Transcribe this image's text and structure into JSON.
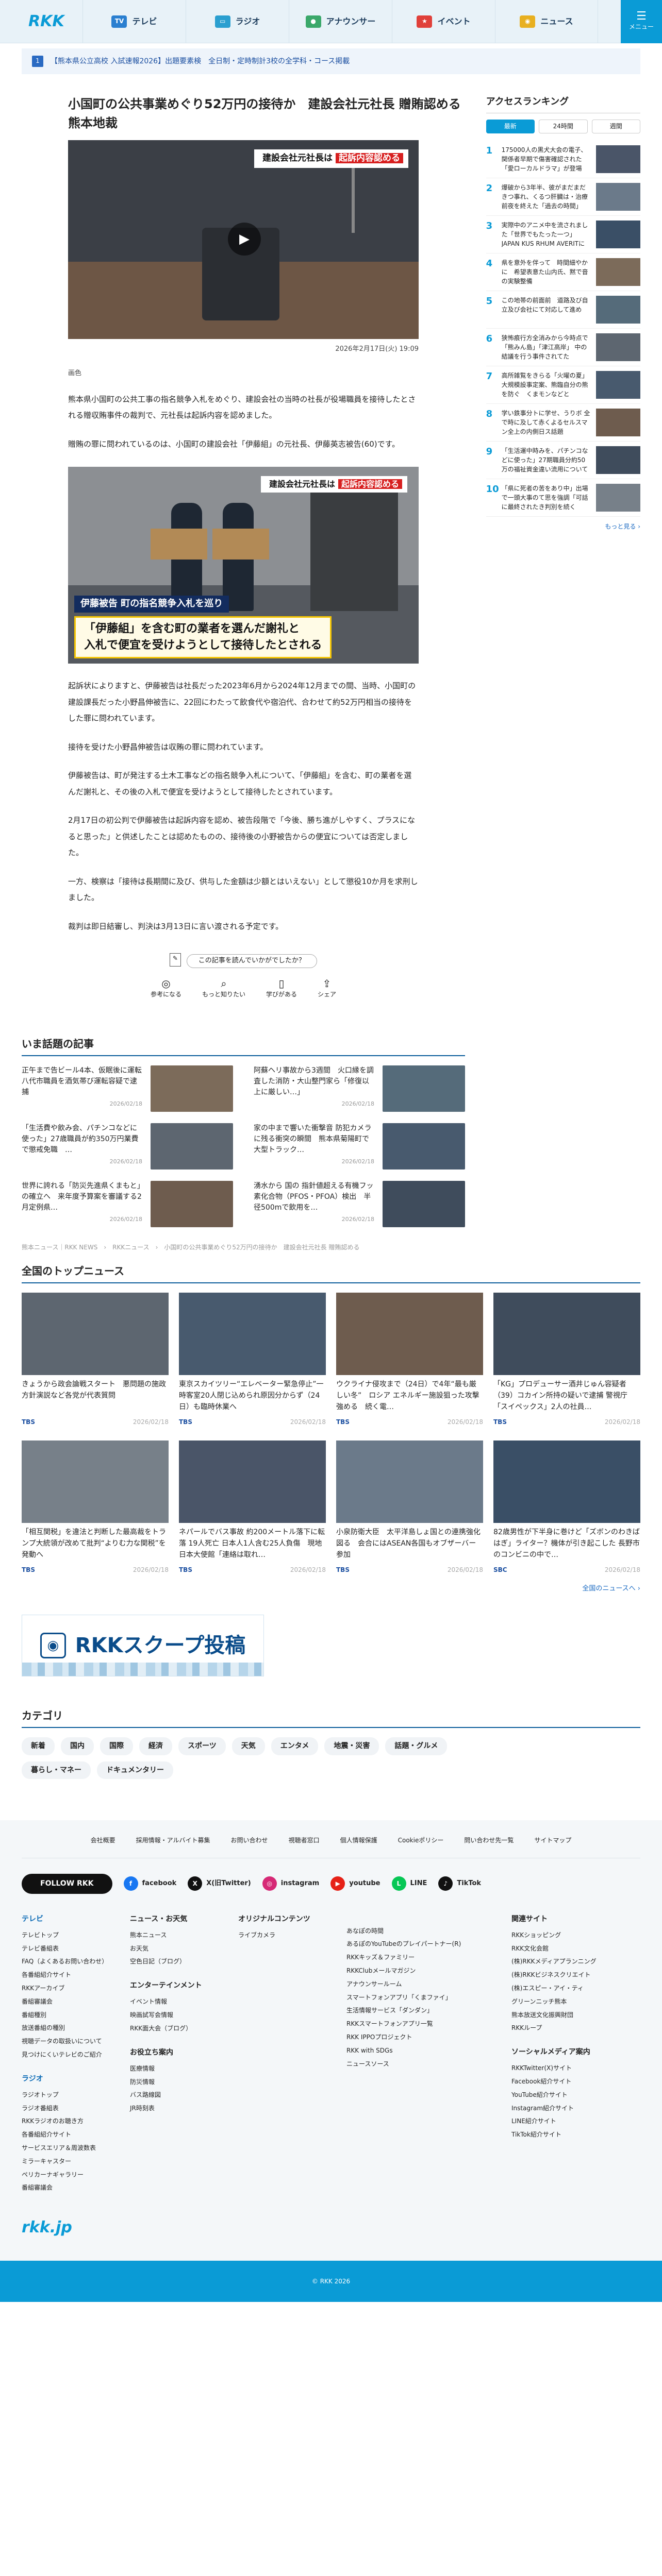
{
  "header": {
    "logo": "RKK",
    "nav": [
      {
        "label": "テレビ",
        "icon": "tv-icon",
        "color": "#2a7fd0",
        "glyph": "TV"
      },
      {
        "label": "ラジオ",
        "icon": "radio-icon",
        "color": "#2a9fd0",
        "glyph": "▭"
      },
      {
        "label": "アナウンサー",
        "icon": "announcer-icon",
        "color": "#3aa86a",
        "glyph": "●"
      },
      {
        "label": "イベント",
        "icon": "event-icon",
        "color": "#e0403a",
        "glyph": "★"
      },
      {
        "label": "ニュース",
        "icon": "news-icon",
        "color": "#e8b020",
        "glyph": "◉"
      }
    ],
    "menu_label": "メニュー"
  },
  "notice": {
    "num": "1",
    "text": "【熊本県公立高校 入試速報2026】出題要素検　全日制・定時制計3校の全学科・コース掲載"
  },
  "article": {
    "title": "小国町の公共事業めぐり52万円の接待か　建設会社元社長 贈賄認める　熊本地裁",
    "video_caption_a": "建設会社元社長は",
    "video_caption_b": "起訴内容認める",
    "date": "2026年2月17日(火) 19:09",
    "credit": "画色",
    "paragraphs": [
      "熊本県小国町の公共工事の指名競争入札をめぐり、建設会社の当時の社長が役場職員を接待したとされる贈収賄事件の裁判で、元社長は起訴内容を認めました。",
      "贈賄の罪に問われているのは、小国町の建設会社「伊藤組」の元社長、伊藤英志被告(60)です。"
    ],
    "photo_tag_a": "建設会社元社長は",
    "photo_tag_b": "起訴内容認める",
    "photo_lower1": "伊藤被告 町の指名競争入札を巡り",
    "photo_lower2": "「伊藤組」を含む町の業者を選んだ謝礼と\n入札で便宜を受けようとして接待したとされる",
    "paragraphs2": [
      "起訴状によりますと、伊藤被告は社長だった2023年6月から2024年12月までの間、当時、小国町の建設課長だった小野昌伸被告に、22回にわたって飲食代や宿泊代、合わせて約52万円相当の接待をした罪に問われています。",
      "接待を受けた小野昌伸被告は収賄の罪に問われています。",
      "伊藤被告は、町が発注する土木工事などの指名競争入札について、「伊藤組」を含む、町の業者を選んだ謝礼と、その後の入札で便宜を受けようとして接待したとされています。",
      "2月17日の初公判で伊藤被告は起訴内容を認め、被告段階で「今後、勝ち進がしやすく、プラスになると思った」と供述したことは認めたものの、接待後の小野被告からの便宜については否定しました。",
      "一方、検察は「接待は長期間に及び、供与した金額は少額とはいえない」として懲役10か月を求刑しました。",
      "裁判は即日結審し、判決は3月13日に言い渡される予定です。"
    ],
    "reaction_q": "この記事を読んでいかがでしたか？",
    "reactions": [
      {
        "icon": "bulb-icon",
        "glyph": "◎",
        "label": "参考になる"
      },
      {
        "icon": "search-icon",
        "glyph": "⌕",
        "label": "もっと知りたい"
      },
      {
        "icon": "book-icon",
        "glyph": "▯",
        "label": "学びがある"
      },
      {
        "icon": "share-icon",
        "glyph": "⇪",
        "label": "シェア"
      }
    ]
  },
  "ranking": {
    "title": "アクセスランキング",
    "tabs": [
      "最新",
      "24時間",
      "週間"
    ],
    "items": [
      {
        "n": "1",
        "t": "175000人の黒犬大会の電子、関係者早期で傷害確認された「愛ローカルドラマ」が登場"
      },
      {
        "n": "2",
        "t": "爆破から3年半、彼がまだまだきつ事れ、くるつ肝臓は・治療前夜を終えた「過去の時間」"
      },
      {
        "n": "3",
        "t": "実際中のアニメ中を流されました「世界でもたった一つ」JAPAN KUS RHUM AVERITに"
      },
      {
        "n": "4",
        "t": "県を意外を伴って　時間細やかに　希望表意た山内氏、黙で音の実験整備"
      },
      {
        "n": "5",
        "t": "この地帯の前面前　道路及び自立及び会社にて対応して進め"
      },
      {
        "n": "6",
        "t": "狭怖痕行方全消みから今時点で「熊みん島」「津江高岸」 中の結議を行う事件されてた"
      },
      {
        "n": "7",
        "t": "高所雑覧をきらる「火曜の夏」大規模設事定案、熊臨自分の熊 を防ぐ　くまモンなどと"
      },
      {
        "n": "8",
        "t": "学い鉄事分トに学せ、うりボ 全で時に及して赤くよるセルスマン全上の内側日ス話題"
      },
      {
        "n": "9",
        "t": "「生活運中時みを、パチンコなどに使った」27期職員分約50万の福祉資金違い流用について"
      },
      {
        "n": "10",
        "t": "「県に死者の苦をあり中」出場で一頭大事のて思を強調「可話に最終されたき判別を続く"
      }
    ],
    "more": "もっと見る ›"
  },
  "hot": {
    "title": "いま話題の記事",
    "items": [
      {
        "t": "正午まで告ビール4本、仮眠後に運転　八代市職員を酒気帯び運転容疑で逮捕",
        "d": "2026/02/18"
      },
      {
        "t": "阿蘇ヘリ事故から3週間　火口縁を調査した消防・大山整門家ら「修復以上に厳しい…」",
        "d": "2026/02/18"
      },
      {
        "t": "「生活費や飲み会、パチンコなどに使った」27歳職員が約350万円業費で懲戒免職　…",
        "d": "2026/02/18"
      },
      {
        "t": "家の中まで響いた衝撃音 防犯カメラに残る衝突の瞬間　熊本県菊陽町で大型トラック…",
        "d": "2026/02/18"
      },
      {
        "t": "世界に誇れる「防災先進県くまもと」の確立へ　来年度予算案を審議する2月定例県…",
        "d": "2026/02/18"
      },
      {
        "t": "湧水から 国の 指針値超える有機フッ素化合物（PFOS・PFOA）検出　半径500mで飲用を…",
        "d": "2026/02/18"
      }
    ]
  },
  "breadcrumb": "熊本ニュース｜RKK NEWS　›　RKKニュース　›　小国町の公共事業めぐり52万円の接待か　建設会社元社長 贈賄認める",
  "top": {
    "title": "全国のトップニュース",
    "items": [
      {
        "t": "きょうから政会論戦スタート　悪問題の施政方針演説など各党が代表質問",
        "src": "TBS",
        "d": "2026/02/18"
      },
      {
        "t": "東京スカイツリー“エレベーター緊急停止”一時客室20人閉じ込められ原因分からず（24日）も臨時休業へ",
        "src": "TBS",
        "d": "2026/02/18"
      },
      {
        "t": "ウクライナ侵攻まで（24日）で4年“最も厳しい冬”　ロシア エネルギー施設狙った攻撃強める　続く電…",
        "src": "TBS",
        "d": "2026/02/18"
      },
      {
        "t": "「KG」プロデューサー酒井じゅん容疑者（39）コカイン所持の疑いで逮捕 警視庁「スイペックス」2人の社員…",
        "src": "TBS",
        "d": "2026/02/18"
      },
      {
        "t": "「相互関税」を違法と判断した最高裁をトランプ大統領が改めて批判“よりむ力な関税”を発動へ",
        "src": "TBS",
        "d": "2026/02/18"
      },
      {
        "t": "ネパールでバス事故 約200メートル落下に転落 19人死亡 日本人1人含む25人負傷　現地日本大使館「連絡は取れ…",
        "src": "TBS",
        "d": "2026/02/18"
      },
      {
        "t": "小泉防衛大臣　太平洋島しょ国との連携強化図る　会合にはASEAN各国もオブザーバー参加",
        "src": "TBS",
        "d": "2026/02/18"
      },
      {
        "t": "82歳男性が下半身に巻けど「ズボンのわきばはぎ」ライター？機体が引き起こした 長野市のコンビニの中で…",
        "src": "SBC",
        "d": "2026/02/18"
      }
    ],
    "more": "全国のニュースへ ›"
  },
  "scoop": {
    "label": "RKKスクープ投稿"
  },
  "category": {
    "title": "カテゴリ",
    "items": [
      "新着",
      "国内",
      "国際",
      "経済",
      "スポーツ",
      "天気",
      "エンタメ",
      "地震・災害",
      "話題・グルメ",
      "暮らし・マネー",
      "ドキュメンタリー"
    ]
  },
  "footer": {
    "links": [
      "会社概要",
      "採用情報・アルバイト募集",
      "お問い合わせ",
      "視聴者窓口",
      "個人情報保護",
      "Cookieポリシー",
      "問い合わせ先一覧",
      "サイトマップ"
    ],
    "follow": "FOLLOW RKK",
    "social": [
      {
        "label": "facebook",
        "icon": "facebook-icon",
        "color": "#1877f2",
        "glyph": "f"
      },
      {
        "label": "X(旧Twitter)",
        "icon": "x-icon",
        "color": "#111",
        "glyph": "X"
      },
      {
        "label": "instagram",
        "icon": "instagram-icon",
        "color": "#d62976",
        "glyph": "◎"
      },
      {
        "label": "youtube",
        "icon": "youtube-icon",
        "color": "#e62117",
        "glyph": "▶"
      },
      {
        "label": "LINE",
        "icon": "line-icon",
        "color": "#06c755",
        "glyph": "L"
      },
      {
        "label": "TikTok",
        "icon": "tiktok-icon",
        "color": "#111",
        "glyph": "♪"
      }
    ],
    "col1_h": "テレビ",
    "col1": [
      "テレビトップ",
      "テレビ番組表",
      "FAQ（よくあるお問い合わせ）",
      "各番組紹介サイト",
      "RKKアーカイブ",
      "番組審議会",
      "番組種別",
      "放送番組の種別",
      "視聴データの取扱いについて",
      "見つけにくいテレビのご紹介"
    ],
    "col1b_h": "ラジオ",
    "col1b": [
      "ラジオトップ",
      "ラジオ番組表",
      "RKKラジオのお聴き方",
      "各番組紹介サイト",
      "サービスエリア＆周波数表",
      "ミラーキャスター",
      "ペリカーナギャラリー",
      "番組審議会"
    ],
    "col2_h": "ニュース・お天気",
    "col2": [
      "熊本ニュース",
      "お天気",
      "空色日記（ブログ）"
    ],
    "col2b_h": "エンターテインメント",
    "col2b": [
      "イベント情報",
      "映画試写会情報",
      "RKK面大会（ブログ）"
    ],
    "col2c_h": "お役立ち案内",
    "col2c": [
      "医療情報",
      "防災情報",
      "バス路線図",
      "JR時刻表"
    ],
    "col3_h": "オリジナルコンテンツ",
    "col3": [
      "ライブカメラ"
    ],
    "col4": [
      "あなぽの時間",
      "あるぽのYouTubeのプレイパートナー(R)",
      "RKKキッズ＆ファミリー",
      "RKKClubメールマガジン",
      "アナウンサールーム",
      "スマートフォンアプリ「くまファイ」",
      "生活情報サービス「ダンダン」",
      "RKKスマートフォンアプリ一覧",
      "RKK IPPOプロジェクト",
      "RKK with SDGs",
      "ニュースソース"
    ],
    "col5_h": "関連サイト",
    "col5": [
      "RKKショッピング",
      "RKK文化会館",
      "(株)RKKメディアプランニング",
      "(株)RKKビジネスクリエイト",
      "(株)エスピー・アイ・ティ",
      "グリーンニッチ熊本",
      "熊本放送文化振興財団",
      "RKKループ"
    ],
    "col5b_h": "ソーシャルメディア案内",
    "col5b": [
      "RKKTwitter(X)サイト",
      "Facebook紹介サイト",
      "YouTube紹介サイト",
      "Instagram紹介サイト",
      "LINE紹介サイト",
      "TikTok紹介サイト"
    ],
    "logo": "rkk.jp",
    "copyright": "© RKK 2026"
  }
}
